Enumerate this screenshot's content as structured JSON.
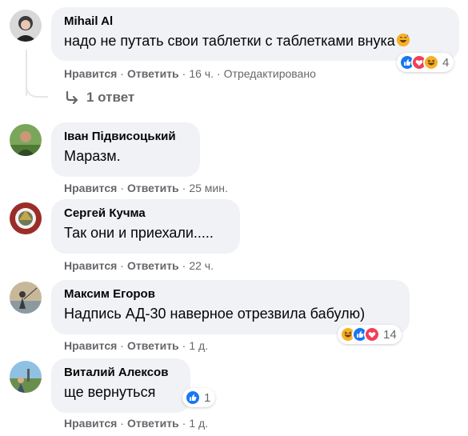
{
  "comments": [
    {
      "author": "Mihail Al",
      "text": "надо не путать свои таблетки с таблетками внука",
      "inline_emoji": "grinning-sweat-emoji",
      "reactions": [
        "like",
        "love",
        "haha"
      ],
      "reaction_count": "4",
      "like_label": "Нравится",
      "reply_label": "Ответить",
      "time": "16 ч.",
      "edited": "Отредактировано",
      "replies_label": "1 ответ"
    },
    {
      "author": "Іван Підвисоцький",
      "text": "Маразм.",
      "like_label": "Нравится",
      "reply_label": "Ответить",
      "time": "25 мин."
    },
    {
      "author": "Сергей Кучма",
      "text": "Так они и приехали.....",
      "like_label": "Нравится",
      "reply_label": "Ответить",
      "time": "22 ч."
    },
    {
      "author": "Максим Егоров",
      "text": "Надпись АД-30 наверное отрезвила бабулю)",
      "reactions": [
        "haha",
        "like",
        "love"
      ],
      "reaction_count": "14",
      "like_label": "Нравится",
      "reply_label": "Ответить",
      "time": "1 д."
    },
    {
      "author": "Виталий Алексов",
      "text": "ще вернуться",
      "reactions": [
        "like"
      ],
      "reaction_count": "1",
      "like_label": "Нравится",
      "reply_label": "Ответить",
      "time": "1 д."
    }
  ],
  "colors": {
    "bubble": "#f0f2f5",
    "meta_text": "#65676b",
    "like_blue": "#1877f2",
    "love_red": "#f33e58",
    "haha_yellow": "#f7b125"
  }
}
